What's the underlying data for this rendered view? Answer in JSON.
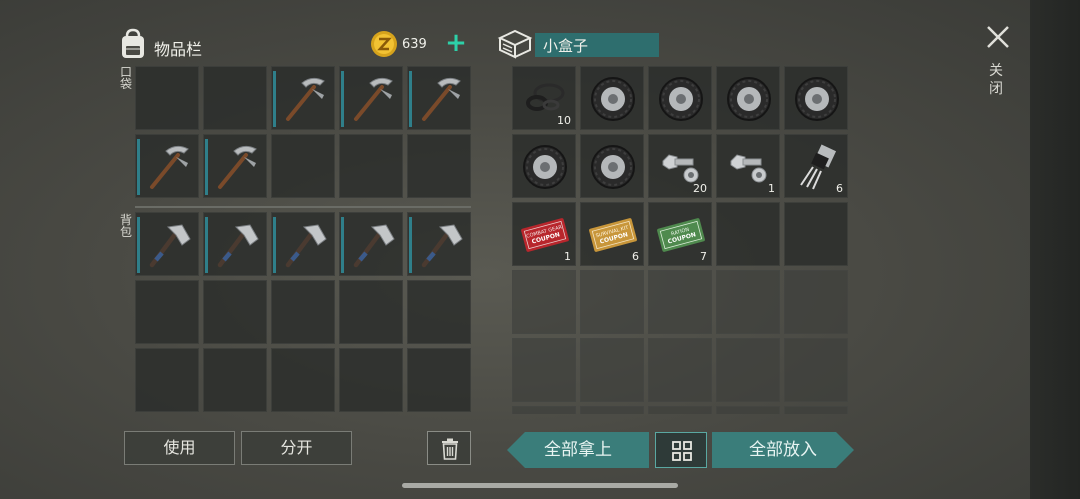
{
  "inventory": {
    "title": "物品栏",
    "coins": "639",
    "plus": "+",
    "pocket_label": "口袋",
    "backpack_label": "背包"
  },
  "pocket_items": [
    {
      "icon": "",
      "qty": ""
    },
    {
      "icon": "",
      "qty": ""
    },
    {
      "icon": "pickaxe-icon",
      "qty": ""
    },
    {
      "icon": "pickaxe-icon",
      "qty": ""
    },
    {
      "icon": "pickaxe-icon",
      "qty": ""
    },
    {
      "icon": "pickaxe-icon",
      "qty": ""
    },
    {
      "icon": "pickaxe-icon",
      "qty": ""
    },
    {
      "icon": "",
      "qty": ""
    },
    {
      "icon": "",
      "qty": ""
    },
    {
      "icon": "",
      "qty": ""
    }
  ],
  "backpack_items": [
    {
      "icon": "hatchet-icon",
      "qty": ""
    },
    {
      "icon": "hatchet-icon",
      "qty": ""
    },
    {
      "icon": "hatchet-icon",
      "qty": ""
    },
    {
      "icon": "hatchet-icon",
      "qty": ""
    },
    {
      "icon": "hatchet-icon",
      "qty": ""
    },
    {
      "icon": "",
      "qty": ""
    },
    {
      "icon": "",
      "qty": ""
    },
    {
      "icon": "",
      "qty": ""
    },
    {
      "icon": "",
      "qty": ""
    },
    {
      "icon": "",
      "qty": ""
    },
    {
      "icon": "",
      "qty": ""
    },
    {
      "icon": "",
      "qty": ""
    },
    {
      "icon": "",
      "qty": ""
    },
    {
      "icon": "",
      "qty": ""
    },
    {
      "icon": "",
      "qty": ""
    }
  ],
  "box": {
    "name": "小盒子",
    "items": [
      {
        "icon": "rubber-seals-icon",
        "qty": "10"
      },
      {
        "icon": "tire-icon",
        "qty": ""
      },
      {
        "icon": "tire-icon",
        "qty": ""
      },
      {
        "icon": "tire-icon",
        "qty": ""
      },
      {
        "icon": "tire-icon",
        "qty": ""
      },
      {
        "icon": "tire-icon",
        "qty": ""
      },
      {
        "icon": "tire-icon",
        "qty": ""
      },
      {
        "icon": "bolt-icon",
        "qty": "20"
      },
      {
        "icon": "bolt-icon",
        "qty": "1"
      },
      {
        "icon": "transistor-icon",
        "qty": "6"
      },
      {
        "icon": "combat-coupon-icon",
        "qty": "1"
      },
      {
        "icon": "survival-coupon-icon",
        "qty": "6"
      },
      {
        "icon": "ration-coupon-icon",
        "qty": "7"
      },
      {
        "icon": "",
        "qty": ""
      },
      {
        "icon": "",
        "qty": ""
      },
      {
        "icon": "",
        "qty": "",
        "empty": true
      },
      {
        "icon": "",
        "qty": "",
        "empty": true
      },
      {
        "icon": "",
        "qty": "",
        "empty": true
      },
      {
        "icon": "",
        "qty": "",
        "empty": true
      },
      {
        "icon": "",
        "qty": "",
        "empty": true
      },
      {
        "icon": "",
        "qty": "",
        "empty": true
      },
      {
        "icon": "",
        "qty": "",
        "empty": true
      },
      {
        "icon": "",
        "qty": "",
        "empty": true
      },
      {
        "icon": "",
        "qty": "",
        "empty": true
      },
      {
        "icon": "",
        "qty": "",
        "empty": true
      },
      {
        "icon": "",
        "qty": "",
        "empty": true
      },
      {
        "icon": "",
        "qty": "",
        "empty": true
      },
      {
        "icon": "",
        "qty": "",
        "empty": true
      },
      {
        "icon": "",
        "qty": "",
        "empty": true
      },
      {
        "icon": "",
        "qty": "",
        "empty": true
      }
    ]
  },
  "buttons": {
    "use": "使用",
    "split": "分开",
    "take_all": "全部拿上",
    "put_all": "全部放入",
    "close": "关闭"
  },
  "colors": {
    "accent": "#2dd0a8",
    "teal": "#3a7d7a",
    "coupon_red": "#b8262c",
    "coupon_gold": "#c8963a",
    "coupon_green": "#4f8a4e"
  }
}
